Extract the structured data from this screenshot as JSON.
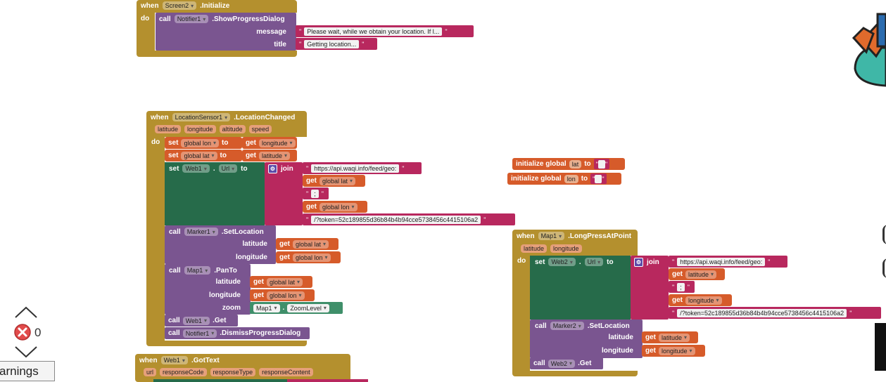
{
  "screen_init": {
    "when": "when",
    "component": "Screen2",
    "event": ".Initialize",
    "do": "do",
    "call": "call",
    "notifier": "Notifier1",
    "method": ".ShowProgressDialog",
    "message_label": "message",
    "message_value": "Please wait, while we obtain your location. If l...",
    "title_label": "title",
    "title_value": "Getting location..."
  },
  "loc_changed": {
    "when": "when",
    "component": "LocationSensor1",
    "event": ".LocationChanged",
    "params": [
      "latitude",
      "longitude",
      "altitude",
      "speed"
    ],
    "do": "do",
    "set": "set",
    "to": "to",
    "get": "get",
    "set_lon_var": "global lon",
    "get_longitude": "longitude",
    "set_lat_var": "global lat",
    "get_latitude": "latitude",
    "web": "Web1",
    "dot": ".",
    "url_prop": "Url",
    "join": "join",
    "url_prefix": "https://api.waqi.info/feed/geo:",
    "get_global_lat": "global lat",
    "separator": ";",
    "get_global_lon": "global lon",
    "token": "/?token=52c189855d36b84b4b94cce5738456c4415106a2",
    "call": "call",
    "marker": "Marker1",
    "set_location": ".SetLocation",
    "latitude_label": "latitude",
    "longitude_label": "longitude",
    "map": "Map1",
    "pan_to": ".PanTo",
    "zoom_label": "zoom",
    "zoom_level": "ZoomLevel",
    "get_method": ".Get",
    "notifier": "Notifier1",
    "dismiss": ".DismissProgressDialog"
  },
  "globals": {
    "init": "initialize global",
    "lat": "lat",
    "lon": "lon",
    "to": "to"
  },
  "long_press": {
    "when": "when",
    "component": "Map1",
    "event": ".LongPressAtPoint",
    "params": [
      "latitude",
      "longitude"
    ],
    "do": "do",
    "set": "set",
    "web": "Web2",
    "dot": ".",
    "url_prop": "Url",
    "to": "to",
    "join": "join",
    "url_prefix": "https://api.waqi.info/feed/geo:",
    "get": "get",
    "get_latitude": "latitude",
    "separator": ";",
    "get_longitude": "longitude",
    "token": "/?token=52c189855d36b84b4b94cce5738456c4415106a2",
    "call": "call",
    "marker": "Marker2",
    "set_location": ".SetLocation",
    "latitude_label": "latitude",
    "longitude_label": "longitude",
    "get_method": ".Get"
  },
  "got_text": {
    "when": "when",
    "component": "Web1",
    "event": ".GotText",
    "params": [
      "url",
      "responseCode",
      "responseType",
      "responseContent"
    ]
  },
  "workspace": {
    "error_count": "0",
    "warnings_label": "arnings"
  }
}
